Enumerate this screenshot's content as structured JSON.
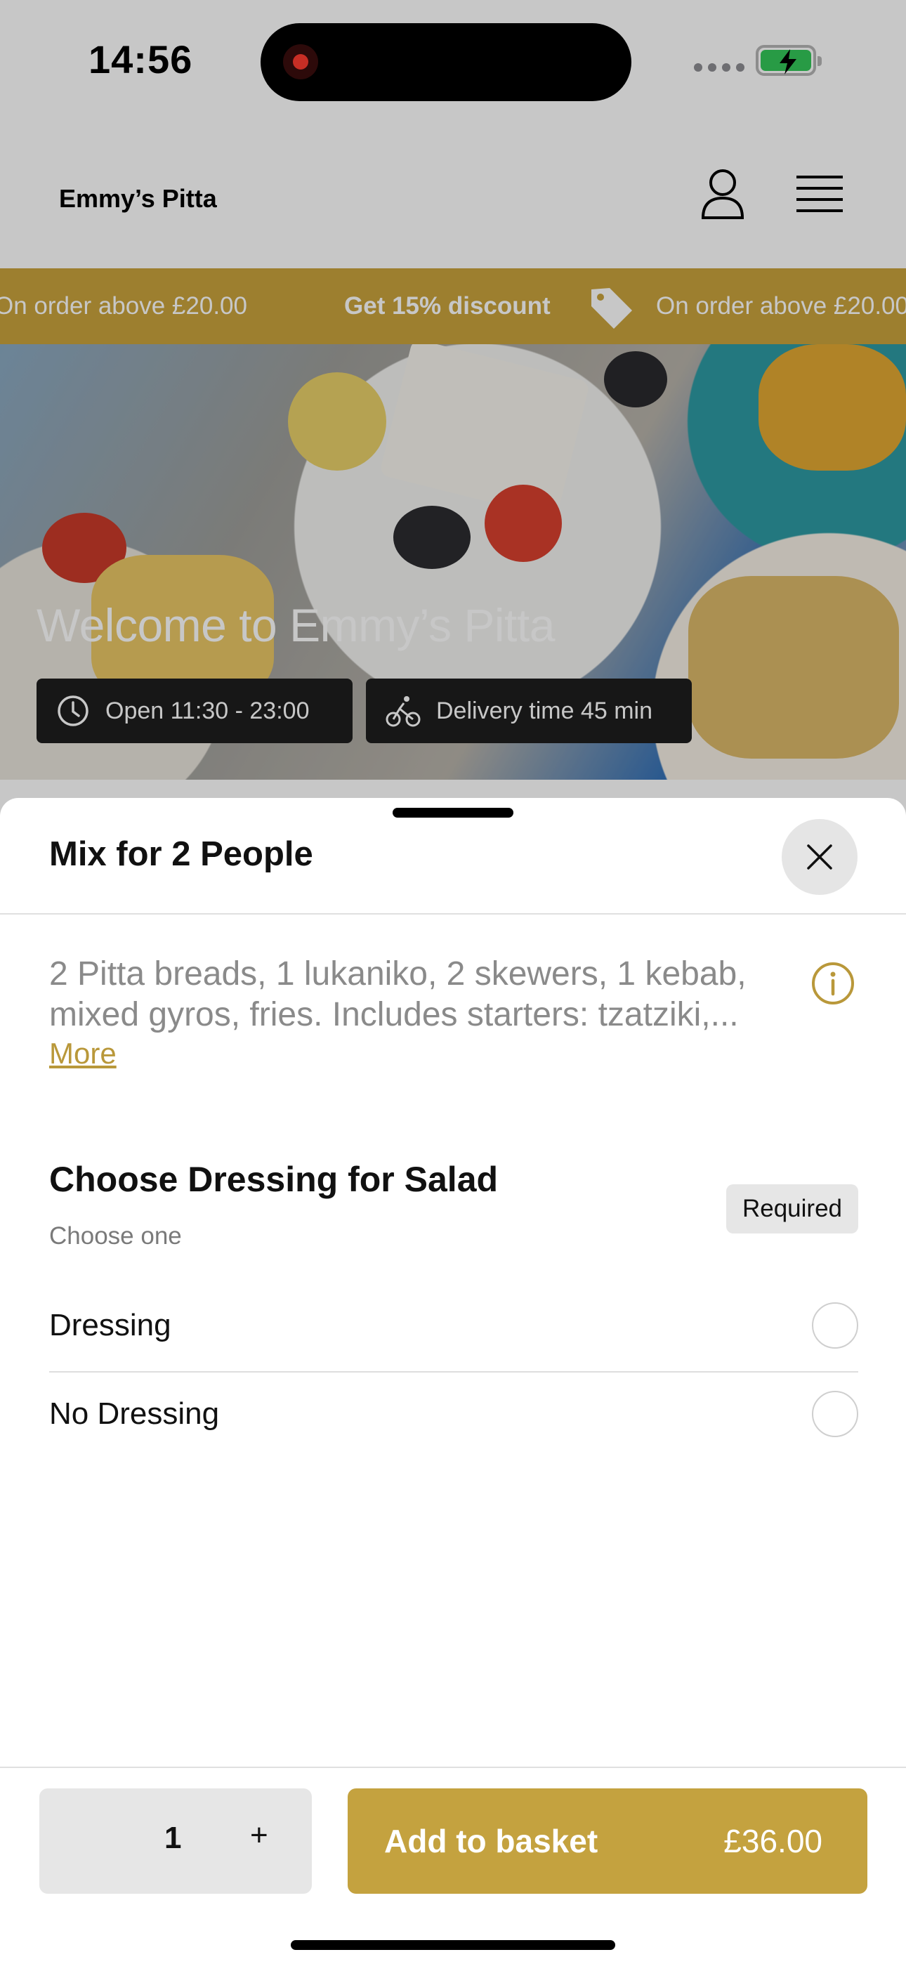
{
  "status_bar": {
    "time": "14:56"
  },
  "header": {
    "brand": "Emmy’s Pitta",
    "icons": [
      "user-icon",
      "hamburger-menu-icon"
    ]
  },
  "promo": {
    "left_text": "On order above £20.00",
    "discount_text": "Get 15% discount",
    "right_text": "On order above £20.00",
    "icon": "tag-icon"
  },
  "hero": {
    "title": "Welcome to Emmy’s Pitta",
    "open_hours": "Open 11:30 - 23:00",
    "delivery_time": "Delivery time 45 min"
  },
  "sheet": {
    "title": "Mix for 2 People",
    "description_line1": "2 Pitta breads, 1 lukaniko, 2 skewers, 1 kebab,",
    "description_line2": "mixed gyros, fries. Includes starters: tzatziki,...",
    "more_label": "More",
    "group": {
      "title": "Choose Dressing for Salad",
      "subtitle": "Choose one",
      "badge": "Required",
      "options": [
        {
          "label": "Dressing",
          "selected": false
        },
        {
          "label": "No Dressing",
          "selected": false
        }
      ]
    }
  },
  "footer": {
    "quantity": "1",
    "plus_label": "+",
    "add_label": "Add to basket",
    "price": "£36.00"
  },
  "colors": {
    "accent": "#c4a23f",
    "promo_bg": "#c9a33d",
    "chip_bg": "#1e1e1e"
  }
}
